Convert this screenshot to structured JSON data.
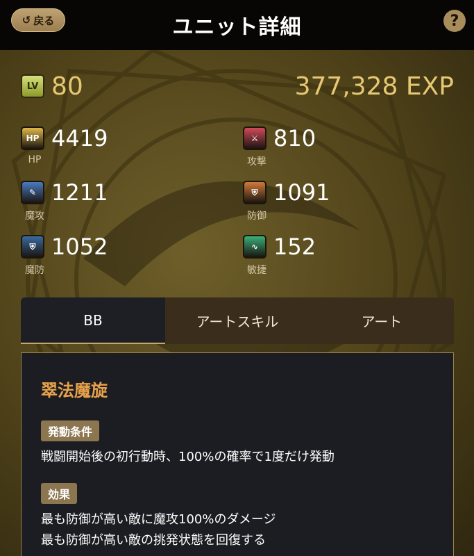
{
  "header": {
    "back_label": "戻る",
    "back_icon": "↺",
    "title": "ユニット詳細",
    "help_label": "?"
  },
  "level": {
    "icon_text": "LV",
    "value": "80",
    "exp": "377,328 EXP"
  },
  "stats": [
    {
      "key": "hp",
      "icon_text": "HP",
      "label": "HP",
      "value": "4419",
      "color": "#e0b84a"
    },
    {
      "key": "atk",
      "icon_text": "⚔",
      "label": "攻撃",
      "value": "810",
      "color": "#d04a5a"
    },
    {
      "key": "matk",
      "icon_text": "✎",
      "label": "魔攻",
      "value": "1211",
      "color": "#4a7ac0"
    },
    {
      "key": "def",
      "icon_text": "⛨",
      "label": "防御",
      "value": "1091",
      "color": "#d07a3a"
    },
    {
      "key": "mdef",
      "icon_text": "⛨",
      "label": "魔防",
      "value": "1052",
      "color": "#3a6aa0"
    },
    {
      "key": "agi",
      "icon_text": "∿",
      "label": "敏捷",
      "value": "152",
      "color": "#3ab07a"
    }
  ],
  "tabs": [
    {
      "label": "BB",
      "active": true
    },
    {
      "label": "アートスキル",
      "active": false
    },
    {
      "label": "アート",
      "active": false
    }
  ],
  "skill": {
    "name": "翠法魔旋",
    "condition_tag": "発動条件",
    "condition_text": "戦闘開始後の初行動時、100%の確率で1度だけ発動",
    "effect_tag": "効果",
    "effect_lines": [
      "最も防御が高い敵に魔攻100%のダメージ",
      "最も防御が高い敵の挑発状態を回復する"
    ]
  }
}
